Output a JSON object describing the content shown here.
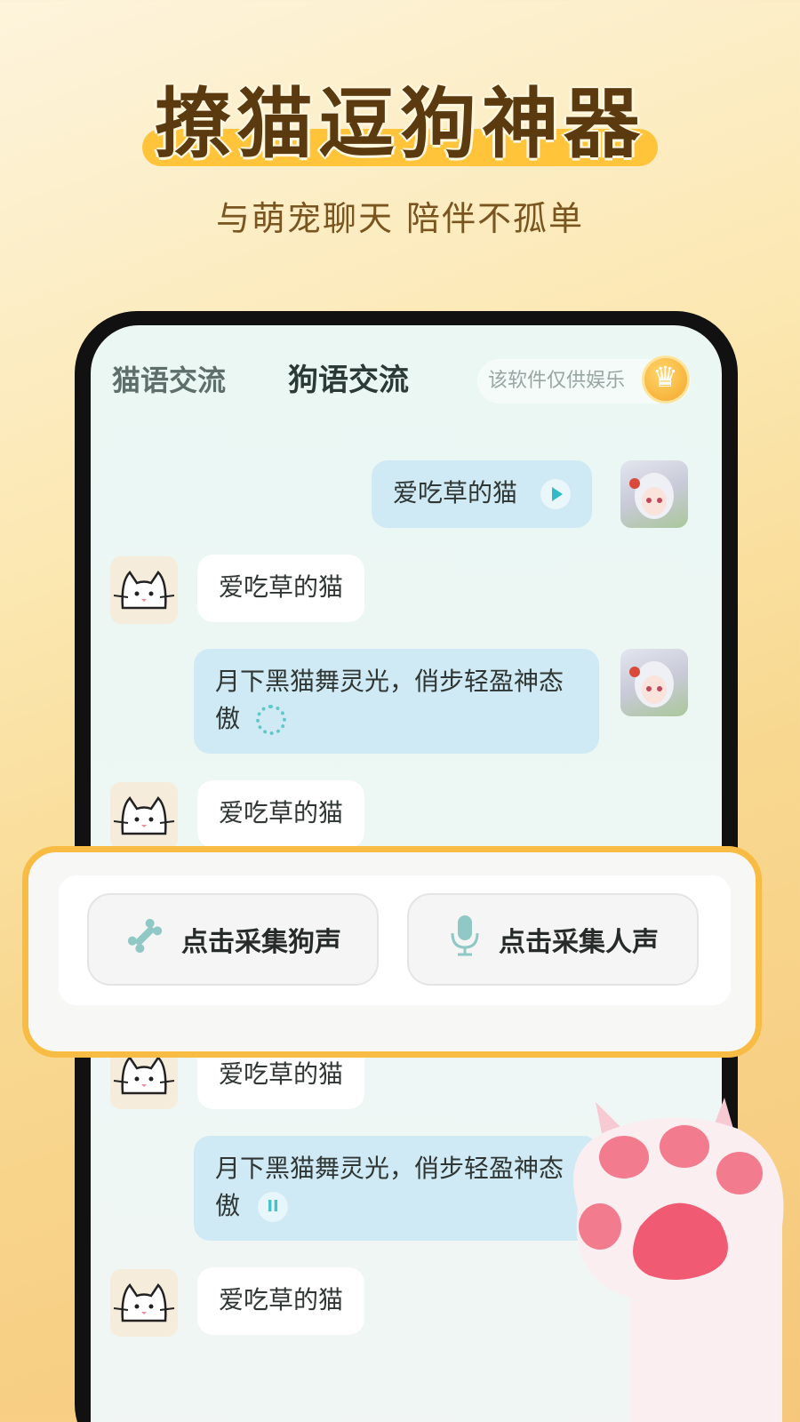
{
  "headline": "撩猫逗狗神器",
  "subtitle": "与萌宠聊天 陪伴不孤单",
  "tabs": {
    "cat": "猫语交流",
    "dog": "狗语交流"
  },
  "notice": "该软件仅供娱乐",
  "messages": [
    {
      "side": "right",
      "text": "爱吃草的猫",
      "indicator": "play"
    },
    {
      "side": "left",
      "text": "爱吃草的猫"
    },
    {
      "side": "right",
      "text": "月下黑猫舞灵光，俏步轻盈神态傲",
      "indicator": "loading"
    },
    {
      "side": "left",
      "text": "爱吃草的猫"
    },
    {
      "side": "left",
      "text": "爱吃草的猫"
    },
    {
      "side": "right",
      "text": "月下黑猫舞灵光，俏步轻盈神态傲",
      "indicator": "pause"
    },
    {
      "side": "left",
      "text": "爱吃草的猫"
    }
  ],
  "actions": {
    "collect_dog": "点击采集狗声",
    "collect_human": "点击采集人声"
  },
  "colors": {
    "accent": "#f8bc45",
    "bubble_blue": "#cfeaf4",
    "icon_teal": "#8fc8c4"
  }
}
